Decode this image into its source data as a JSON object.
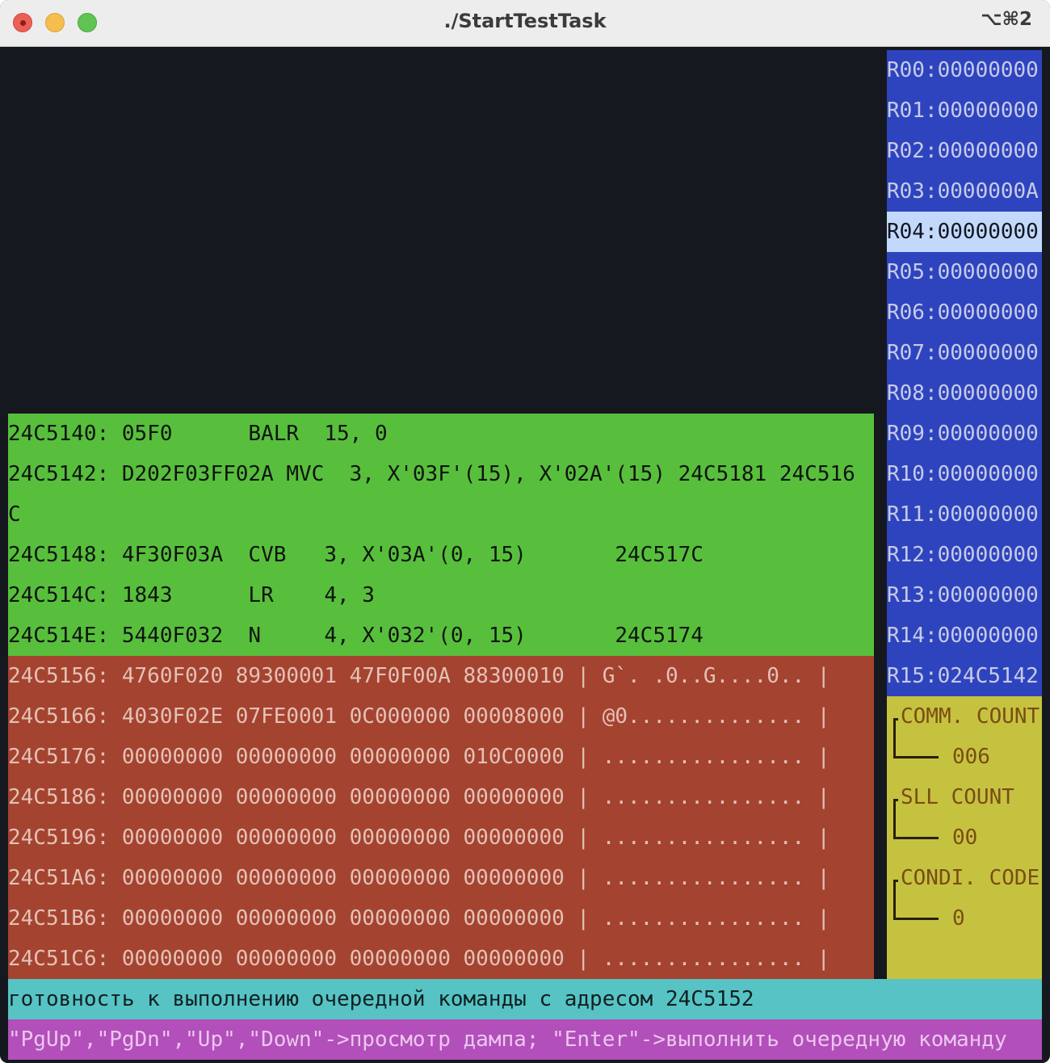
{
  "window": {
    "title": "./StartTestTask",
    "shortcut": "⌥⌘2"
  },
  "code_lines": [
    "24C5140: 05F0      BALR  15, 0",
    "24C5142: D202F03FF02A MVC  3, X'03F'(15), X'02A'(15) 24C5181 24C516",
    "C",
    "24C5148: 4F30F03A  CVB   3, X'03A'(0, 15)       24C517C",
    "24C514C: 1843      LR    4, 3",
    "24C514E: 5440F032  N     4, X'032'(0, 15)       24C5174"
  ],
  "dump_lines": [
    "24C5156: 4760F020 89300001 47F0F00A 88300010 | G`. .0..G....0.. |",
    "24C5166: 4030F02E 07FE0001 0C000000 00008000 | @0.............. |",
    "24C5176: 00000000 00000000 00000000 010C0000 | ................ |",
    "24C5186: 00000000 00000000 00000000 00000000 | ................ |",
    "24C5196: 00000000 00000000 00000000 00000000 | ................ |",
    "24C51A6: 00000000 00000000 00000000 00000000 | ................ |",
    "24C51B6: 00000000 00000000 00000000 00000000 | ................ |",
    "24C51C6: 00000000 00000000 00000000 00000000 | ................ |"
  ],
  "registers": [
    "R00:00000000",
    "R01:00000000",
    "R02:00000000",
    "R03:0000000A",
    "R04:00000000",
    "R05:00000000",
    "R06:00000000",
    "R07:00000000",
    "R08:00000000",
    "R09:00000000",
    "R10:00000000",
    "R11:00000000",
    "R12:00000000",
    "R13:00000000",
    "R14:00000000",
    "R15:024C5142"
  ],
  "selected_register": "R04",
  "counters": {
    "comm_label": "COMM. COUNT",
    "comm_value": "006",
    "sll_label": "SLL COUNT",
    "sll_value": "00",
    "cond_label": "CONDI. CODE",
    "cond_value": "0"
  },
  "status": "готовность к выполнению очередной команды с адресом 24C5152",
  "help": "\"PgUp\",\"PgDn\",\"Up\",\"Down\"->просмотр дампа; \"Enter\"->выполнить очередную команду",
  "colors": {
    "terminal_bg": "#15181f",
    "code_bg": "#58bf3c",
    "dump_bg": "#a54331",
    "registers_bg": "#2e44bf",
    "register_selected_bg": "#c3d9fb",
    "counters_bg": "#c5c240",
    "status_bg": "#57c3c4",
    "help_bg": "#b24fba"
  }
}
